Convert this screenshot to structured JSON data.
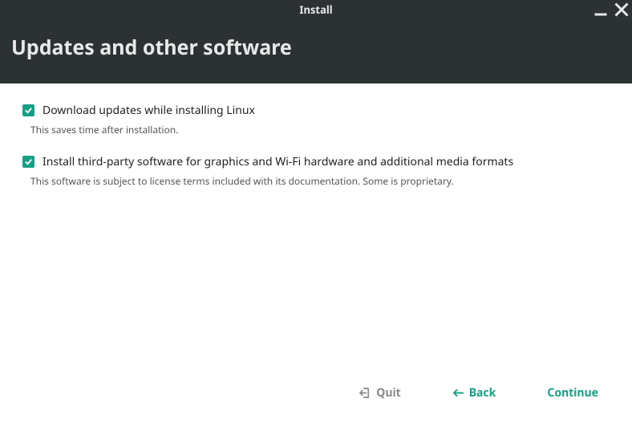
{
  "window": {
    "title": "Install"
  },
  "header": {
    "title": "Updates and other software"
  },
  "options": {
    "download_updates": {
      "label": "Download updates while installing Linux",
      "description": "This saves time after installation.",
      "checked": true
    },
    "third_party": {
      "label": "Install third-party software for graphics and Wi-Fi hardware and additional media formats",
      "description": "This software is subject to license terms included with its documentation. Some is proprietary.",
      "checked": true
    }
  },
  "footer": {
    "quit": "Quit",
    "back": "Back",
    "continue": "Continue"
  },
  "colors": {
    "accent": "#16a085",
    "header_bg": "#2c3133"
  }
}
